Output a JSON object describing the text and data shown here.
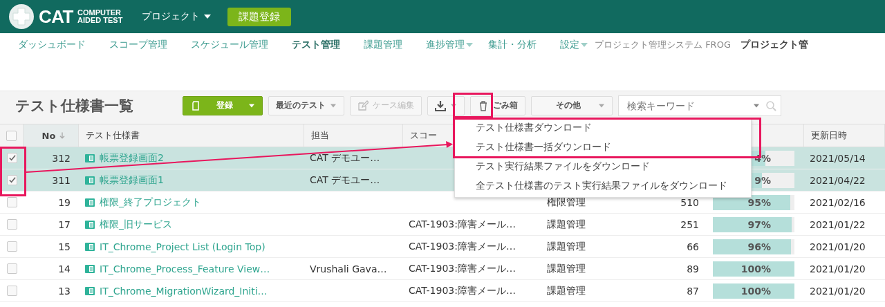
{
  "header": {
    "logo": {
      "main": "CAT",
      "line1": "COMPUTER",
      "line2": "AIDED TEST"
    },
    "project_menu": "プロジェクト",
    "issue_button": "課題登録"
  },
  "nav": {
    "items": [
      {
        "label": "ダッシュボード",
        "selected": false,
        "dropdown": false
      },
      {
        "label": "スコープ管理",
        "selected": false,
        "dropdown": false
      },
      {
        "label": "スケジュール管理",
        "selected": false,
        "dropdown": false
      },
      {
        "label": "テスト管理",
        "selected": true,
        "dropdown": false
      },
      {
        "label": "課題管理",
        "selected": false,
        "dropdown": false
      },
      {
        "label": "進捗管理",
        "selected": false,
        "dropdown": true
      },
      {
        "label": "集計・分析",
        "selected": false,
        "dropdown": false
      },
      {
        "label": "設定",
        "selected": false,
        "dropdown": true
      }
    ],
    "system_name": "プロジェクト管理システム FROG",
    "project_name": "プロジェクト管"
  },
  "toolbar": {
    "title": "テスト仕様書一覧",
    "register": "登録",
    "recent": "最近のテスト",
    "edit_cases": {
      "label": "ケース編集",
      "disabled": true
    },
    "trash": "ごみ箱",
    "other": "その他",
    "search": {
      "placeholder": "検索キーワード"
    }
  },
  "download_menu": {
    "items": [
      {
        "label": "テスト仕様書ダウンロード"
      },
      {
        "label": "テスト仕様書一括ダウンロード"
      },
      {
        "label": "テスト実行結果ファイルをダウンロード"
      },
      {
        "label": "全テスト仕様書のテスト実行結果ファイルをダウンロード"
      }
    ]
  },
  "table": {
    "select_all": {
      "checked": false
    },
    "columns": [
      "No",
      "テスト仕様書",
      "担当",
      "スコー",
      "更新日時"
    ],
    "rows": [
      {
        "checked": true,
        "selected": true,
        "no": "312",
        "spec": "帳票登録画面2",
        "person": "CAT デモユー…",
        "progress": {
          "level": 0.64,
          "reading": "4%"
        },
        "date": "2021/05/14"
      },
      {
        "checked": true,
        "selected": true,
        "no": "311",
        "spec": "帳票登録画面1",
        "person": "CAT デモユー…",
        "progress": {
          "level": 0.6,
          "reading": "9%"
        },
        "date": "2021/04/22"
      },
      {
        "checked": false,
        "selected": false,
        "no": "19",
        "spec": "権限_終了プロジェクト",
        "category": "権限管理",
        "count": "510",
        "progress": {
          "level": 0.95,
          "reading": "95%"
        },
        "date": "2021/02/16"
      },
      {
        "checked": false,
        "selected": false,
        "no": "17",
        "spec": "権限_旧サービス",
        "scope": "CAT-1903:障害メール…",
        "category": "課題管理",
        "count": "251",
        "progress": {
          "level": 0.97,
          "reading": "97%"
        },
        "date": "2021/01/22"
      },
      {
        "checked": false,
        "selected": false,
        "no": "15",
        "spec": "IT_Chrome_Project List (Login Top)",
        "scope": "CAT-1903:障害メール…",
        "category": "課題管理",
        "count": "66",
        "progress": {
          "level": 0.96,
          "reading": "96%"
        },
        "date": "2021/01/20"
      },
      {
        "checked": false,
        "selected": false,
        "no": "14",
        "spec": "IT_Chrome_Process_Feature View…",
        "person": "Vrushali Gava…",
        "scope": "CAT-1903:障害メール…",
        "category": "課題管理",
        "count": "89",
        "progress": {
          "level": 1,
          "reading": "100%"
        },
        "date": "2021/01/20"
      },
      {
        "checked": false,
        "selected": false,
        "no": "13",
        "spec": "IT_Chrome_MigrationWizard_Initi…",
        "scope": "CAT-1903:障害メール…",
        "category": "課題管理",
        "count": "87",
        "progress": {
          "level": 1,
          "reading": "100%"
        },
        "date": "2021/01/20"
      }
    ]
  }
}
